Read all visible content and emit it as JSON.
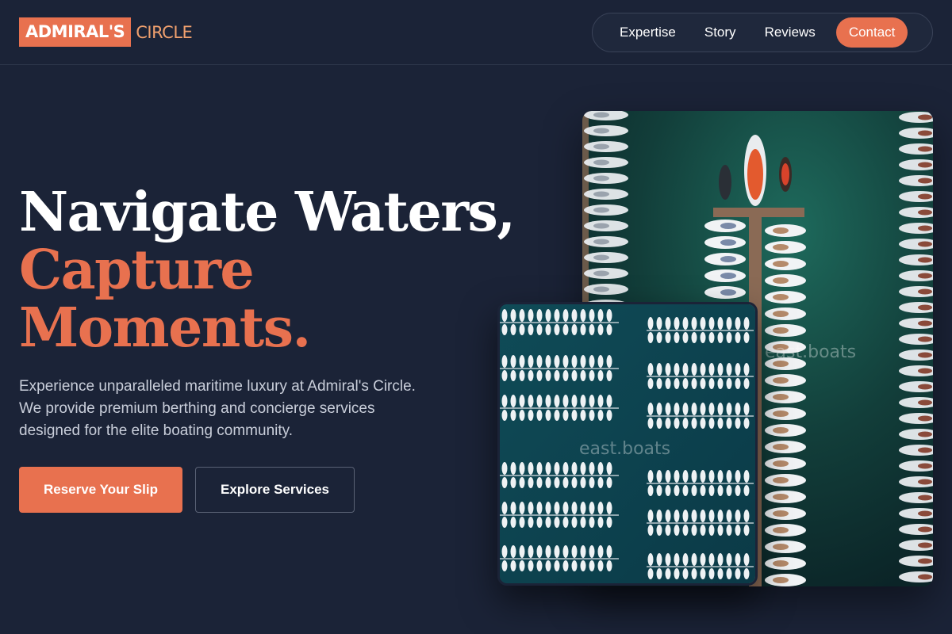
{
  "brand": {
    "name_highlight": "ADMIRAL'S",
    "name_rest": "CIRCLE",
    "accent": "#e8714f",
    "background": "#1b2337"
  },
  "nav": {
    "items": [
      {
        "label": "Expertise"
      },
      {
        "label": "Story"
      },
      {
        "label": "Reviews"
      },
      {
        "label": "Contact"
      }
    ]
  },
  "hero": {
    "headline_line1": "Navigate Waters,",
    "headline_line2": "Capture Moments.",
    "description": "Experience unparalleled maritime luxury at Admiral's Circle. We provide premium berthing and concierge services designed for the elite boating community.",
    "primary_button": "Reserve Your Slip",
    "secondary_button": "Explore Services"
  },
  "images": {
    "main_watermark": "east.boats",
    "small_watermark": "east.boats"
  }
}
